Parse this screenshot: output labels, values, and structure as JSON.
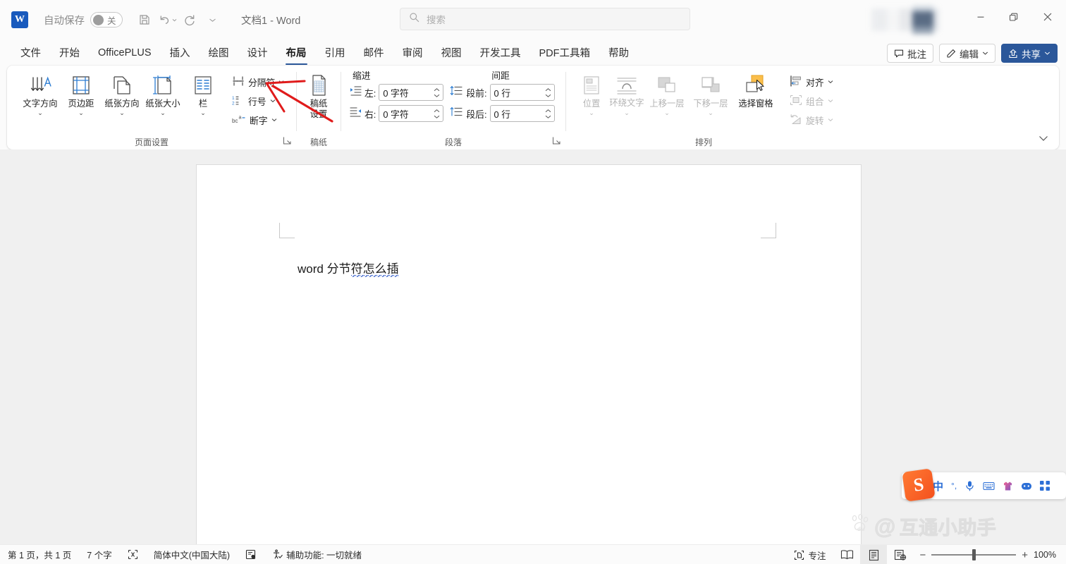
{
  "titlebar": {
    "app_logo": "word-logo",
    "autosave_label": "自动保存",
    "autosave_state": "关",
    "document_title": "文档1 - Word",
    "quick_access": [
      {
        "name": "save-icon",
        "label": "保存"
      },
      {
        "name": "undo-icon",
        "label": "撤消"
      },
      {
        "name": "redo-icon",
        "label": "恢复"
      },
      {
        "name": "customize-qat-icon",
        "label": "自定义快速访问工具栏"
      }
    ],
    "window_controls": [
      {
        "name": "minimize-button",
        "glyph": "—"
      },
      {
        "name": "restore-button",
        "glyph": "❐"
      },
      {
        "name": "close-button",
        "glyph": "✕"
      }
    ]
  },
  "search": {
    "placeholder": "搜索",
    "icon": "search-icon"
  },
  "tabs": [
    {
      "label": "文件",
      "active": false
    },
    {
      "label": "开始",
      "active": false
    },
    {
      "label": "OfficePLUS",
      "active": false
    },
    {
      "label": "插入",
      "active": false
    },
    {
      "label": "绘图",
      "active": false
    },
    {
      "label": "设计",
      "active": false
    },
    {
      "label": "布局",
      "active": true
    },
    {
      "label": "引用",
      "active": false
    },
    {
      "label": "邮件",
      "active": false
    },
    {
      "label": "审阅",
      "active": false
    },
    {
      "label": "视图",
      "active": false
    },
    {
      "label": "开发工具",
      "active": false
    },
    {
      "label": "PDF工具箱",
      "active": false
    },
    {
      "label": "帮助",
      "active": false
    }
  ],
  "tab_actions": {
    "comments": "批注",
    "editing": "编辑",
    "share": "共享"
  },
  "ribbon": {
    "groups": [
      {
        "name": "page-setup",
        "label": "页面设置",
        "has_dialog_launcher": true,
        "buttons": [
          {
            "label": "文字方向",
            "icon": "text-direction-icon",
            "dropdown": true,
            "disabled": false
          },
          {
            "label": "页边距",
            "icon": "margins-icon",
            "dropdown": true,
            "disabled": false
          },
          {
            "label": "纸张方向",
            "icon": "orientation-icon",
            "dropdown": true,
            "disabled": false
          },
          {
            "label": "纸张大小",
            "icon": "paper-size-icon",
            "dropdown": true,
            "disabled": false
          },
          {
            "label": "栏",
            "icon": "columns-icon",
            "dropdown": true,
            "disabled": false
          }
        ],
        "small_buttons": [
          {
            "label": "分隔符",
            "icon": "breaks-icon",
            "dropdown": true,
            "disabled": false
          },
          {
            "label": "行号",
            "icon": "line-numbers-icon",
            "dropdown": true,
            "disabled": false
          },
          {
            "label": "断字",
            "icon": "hyphenation-icon",
            "dropdown": true,
            "disabled": false
          }
        ]
      },
      {
        "name": "manuscript",
        "label": "稿纸",
        "has_dialog_launcher": false,
        "buttons": [
          {
            "label": "稿纸\n设置",
            "label_line1": "稿纸",
            "label_line2": "设置",
            "icon": "manuscript-grid-icon",
            "dropdown": false,
            "disabled": false
          }
        ]
      },
      {
        "name": "paragraph",
        "label": "段落",
        "has_dialog_launcher": true,
        "section_indent": "缩进",
        "section_spacing": "间距",
        "fields": [
          {
            "label": "左:",
            "value": "0 字符",
            "icon": "indent-left-icon"
          },
          {
            "label": "右:",
            "value": "0 字符",
            "icon": "indent-right-icon"
          },
          {
            "label": "段前:",
            "value": "0 行",
            "icon": "space-before-icon"
          },
          {
            "label": "段后:",
            "value": "0 行",
            "icon": "space-after-icon"
          }
        ]
      },
      {
        "name": "arrange",
        "label": "排列",
        "has_dialog_launcher": false,
        "buttons": [
          {
            "label": "位置",
            "icon": "position-icon",
            "dropdown": true,
            "disabled": true
          },
          {
            "label": "环绕文字",
            "icon": "wrap-text-icon",
            "dropdown": true,
            "disabled": true
          },
          {
            "label": "上移一层",
            "icon": "bring-forward-icon",
            "dropdown": true,
            "disabled": true
          },
          {
            "label": "下移一层",
            "icon": "send-backward-icon",
            "dropdown": true,
            "disabled": true
          },
          {
            "label": "选择窗格",
            "icon": "selection-pane-icon",
            "dropdown": false,
            "disabled": false
          }
        ],
        "small_buttons": [
          {
            "label": "对齐",
            "icon": "align-icon",
            "dropdown": true,
            "disabled": false
          },
          {
            "label": "组合",
            "icon": "group-icon",
            "dropdown": true,
            "disabled": true
          },
          {
            "label": "旋转",
            "icon": "rotate-icon",
            "dropdown": true,
            "disabled": true
          }
        ]
      }
    ],
    "collapse_icon": "chevron-down-icon"
  },
  "document": {
    "text_plain": "word ",
    "text_normal": "分节",
    "text_misspelled": "符怎么插"
  },
  "annotation": {
    "type": "red-arrow",
    "color": "#e01b1b",
    "points_to": "分隔符"
  },
  "ime": {
    "name": "sogou-input-toolbar",
    "logo_text": "S",
    "items": [
      {
        "name": "ime-mode-chinese",
        "glyph": "中"
      },
      {
        "name": "ime-punctuation",
        "glyph": "°,"
      },
      {
        "name": "ime-voice-icon",
        "glyph": "🎤"
      },
      {
        "name": "ime-keyboard-icon",
        "glyph": "⌨"
      },
      {
        "name": "ime-skin-icon",
        "glyph": "👕"
      },
      {
        "name": "ime-emoji-icon",
        "glyph": "☺"
      },
      {
        "name": "ime-toolbox-icon",
        "glyph": "▦"
      }
    ]
  },
  "watermark": {
    "at": "@",
    "text": "互通小助手",
    "brand": "du"
  },
  "statusbar": {
    "page_info": "第 1 页，共 1 页",
    "word_count": "7 个字",
    "proofing_icon": "spell-check-icon",
    "language": "简体中文(中国大陆)",
    "track_changes_icon": "track-changes-icon",
    "accessibility": "辅助功能: 一切就绪",
    "focus_label": "专注",
    "views": [
      {
        "name": "read-mode-view",
        "selected": false
      },
      {
        "name": "print-layout-view",
        "selected": true
      },
      {
        "name": "web-layout-view",
        "selected": false
      }
    ],
    "zoom_minus": "−",
    "zoom_plus": "+",
    "zoom_level": "100%"
  }
}
